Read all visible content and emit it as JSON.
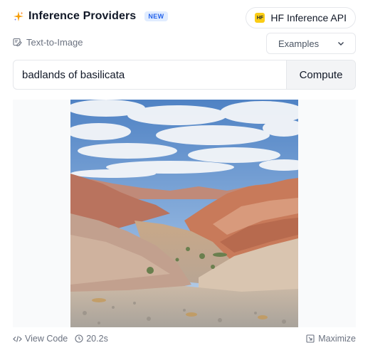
{
  "header": {
    "title": "Inference Providers",
    "badge": "NEW",
    "provider": {
      "logo_text": "HF",
      "label": "HF Inference API"
    }
  },
  "task": {
    "label": "Text-to-Image",
    "examples_label": "Examples"
  },
  "input": {
    "value": "badlands of basilicata"
  },
  "actions": {
    "compute_label": "Compute"
  },
  "result": {
    "image_alt": "Generated image: eroded badland hills under a blue sky with white clouds"
  },
  "footer": {
    "view_code_label": "View Code",
    "duration": "20.2s",
    "maximize_label": "Maximize"
  },
  "colors": {
    "accent": "#2563eb",
    "badge_bg": "#e0ecff",
    "hf_yellow": "#facc15"
  },
  "icons": [
    "sparkle-icon",
    "hf-logo-icon",
    "text-to-image-icon",
    "chevron-down-icon",
    "code-icon",
    "clock-icon",
    "maximize-icon"
  ]
}
